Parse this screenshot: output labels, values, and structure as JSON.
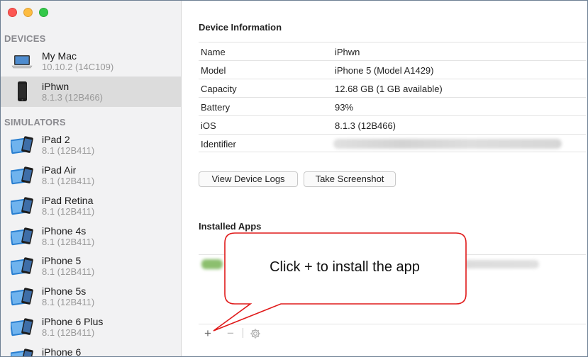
{
  "sidebar": {
    "devices_header": "DEVICES",
    "simulators_header": "SIMULATORS",
    "devices": [
      {
        "name": "My Mac",
        "sub": "10.10.2 (14C109)"
      },
      {
        "name": "iPhwn",
        "sub": "8.1.3 (12B466)"
      }
    ],
    "simulators": [
      {
        "name": "iPad 2",
        "sub": "8.1 (12B411)"
      },
      {
        "name": "iPad Air",
        "sub": "8.1 (12B411)"
      },
      {
        "name": "iPad Retina",
        "sub": "8.1 (12B411)"
      },
      {
        "name": "iPhone 4s",
        "sub": "8.1 (12B411)"
      },
      {
        "name": "iPhone 5",
        "sub": "8.1 (12B411)"
      },
      {
        "name": "iPhone 5s",
        "sub": "8.1 (12B411)"
      },
      {
        "name": "iPhone 6 Plus",
        "sub": "8.1 (12B411)"
      },
      {
        "name": "iPhone 6",
        "sub": ""
      }
    ]
  },
  "main": {
    "device_info_title": "Device Information",
    "info": [
      {
        "label": "Name",
        "value": "iPhwn"
      },
      {
        "label": "Model",
        "value": "iPhone 5 (Model A1429)"
      },
      {
        "label": "Capacity",
        "value": "12.68 GB (1 GB available)"
      },
      {
        "label": "Battery",
        "value": "93%"
      },
      {
        "label": "iOS",
        "value": "8.1.3 (12B466)"
      },
      {
        "label": "Identifier",
        "value": ""
      }
    ],
    "view_logs_label": "View Device Logs",
    "screenshot_label": "Take Screenshot",
    "installed_apps_title": "Installed Apps",
    "plus": "+",
    "minus": "−"
  },
  "callout": {
    "text": "Click + to install the app"
  },
  "colors": {
    "callout_border": "#e01a1a",
    "selected_row": "#dcdcdc"
  }
}
